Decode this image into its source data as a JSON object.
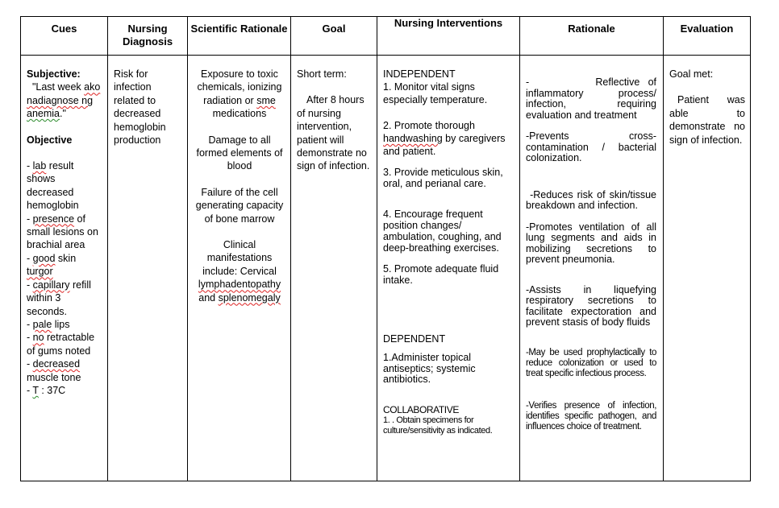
{
  "headers": [
    "Cues",
    "Nursing Diagnosis",
    "Scientific Rationale",
    "Goal",
    "Nursing Interventions",
    "Rationale",
    "Evaluation"
  ],
  "cues": {
    "subjective_label": "Subjective:",
    "subjective_quote_1": "\"Last week ",
    "subjective_word_ako": "ako",
    "subjective_word_nadiagnose": "nadiagnose ng",
    "subjective_word_anemia": "anemia",
    "subjective_quote_end": ".\"",
    "objective_label": "Objective",
    "items": [
      {
        "pre": "-  ",
        "sq": "lab",
        "post": " result shows decreased hemoglobin"
      },
      {
        "pre": "- ",
        "sq": "presence",
        "post": " of small lesions on brachial area"
      },
      {
        "pre": "- ",
        "sq": "good",
        "post": " skin "
      },
      {
        "pre": "",
        "sq": "turgor",
        "post": ""
      },
      {
        "pre": "- ",
        "sq": "capillary",
        "post": " refill within 3 seconds."
      },
      {
        "pre": "- ",
        "sq": "pale",
        "post": " lips"
      },
      {
        "pre": "- ",
        "sq": "no",
        "post": " retractable of gums noted"
      },
      {
        "pre": "- ",
        "sq": "decreased",
        "post": " muscle tone"
      },
      {
        "pre": "- ",
        "sq": "T",
        "post": " : 37C"
      }
    ]
  },
  "diagnosis": "Risk for infection related to decreased hemoglobin production",
  "scientific_rationale": {
    "p1_a": "Exposure to toxic chemicals, ionizing radiation or ",
    "p1_sq": "sme",
    "p1_b": " medications",
    "p2": "Damage to all formed elements of blood",
    "p3": "Failure of the cell generating capacity of bone marrow",
    "p4_a": "Clinical manifestations include: Cervical ",
    "p4_sq1": "lymphadentopathy",
    "p4_b": " and ",
    "p4_sq2": "splenomegaly"
  },
  "goal": {
    "label": "Short term:",
    "text": "After 8 hours of nursing intervention, patient will demonstrate no sign of infection."
  },
  "interventions": {
    "independent_label": "INDEPENDENT",
    "i1": "1. Monitor vital signs especially temperature.",
    "i2_a": "2.  Promote thorough ",
    "i2_sq": "handwashing",
    "i2_b": " by caregivers and patient.",
    "i3": "3. Provide meticulous skin, oral, and perianal care.",
    "i4": "4. Encourage frequent position changes/ ambulation, coughing, and deep-breathing exercises.",
    "i5": "5. Promote adequate fluid intake.",
    "dependent_label": "DEPENDENT",
    "d1": "1.Administer topical antiseptics; systemic antibiotics.",
    "collaborative_label": "COLLABORATIVE",
    "c1": "1. . Obtain specimens for culture/sensitivity as indicated."
  },
  "rationale": [
    "-        Reflective of inflammatory process/ infection, requiring evaluation and treatment",
    "-Prevents cross-contamination / bacterial colonization.",
    " -Reduces risk of skin/tissue breakdown and infection.",
    "-Promotes ventilation of all lung segments and aids in mobilizing secretions to prevent pneumonia.",
    "-Assists in liquefying respiratory secretions to facilitate expectoration and prevent stasis of body fluids",
    "-May be used prophylactically to reduce colonization or used to treat specific infectious process.",
    "-Verifies presence of infection, identifies specific pathogen, and influences choice of treatment."
  ],
  "evaluation": {
    "label": "Goal met:",
    "text": "Patient was able to demonstrate no sign of infection."
  }
}
